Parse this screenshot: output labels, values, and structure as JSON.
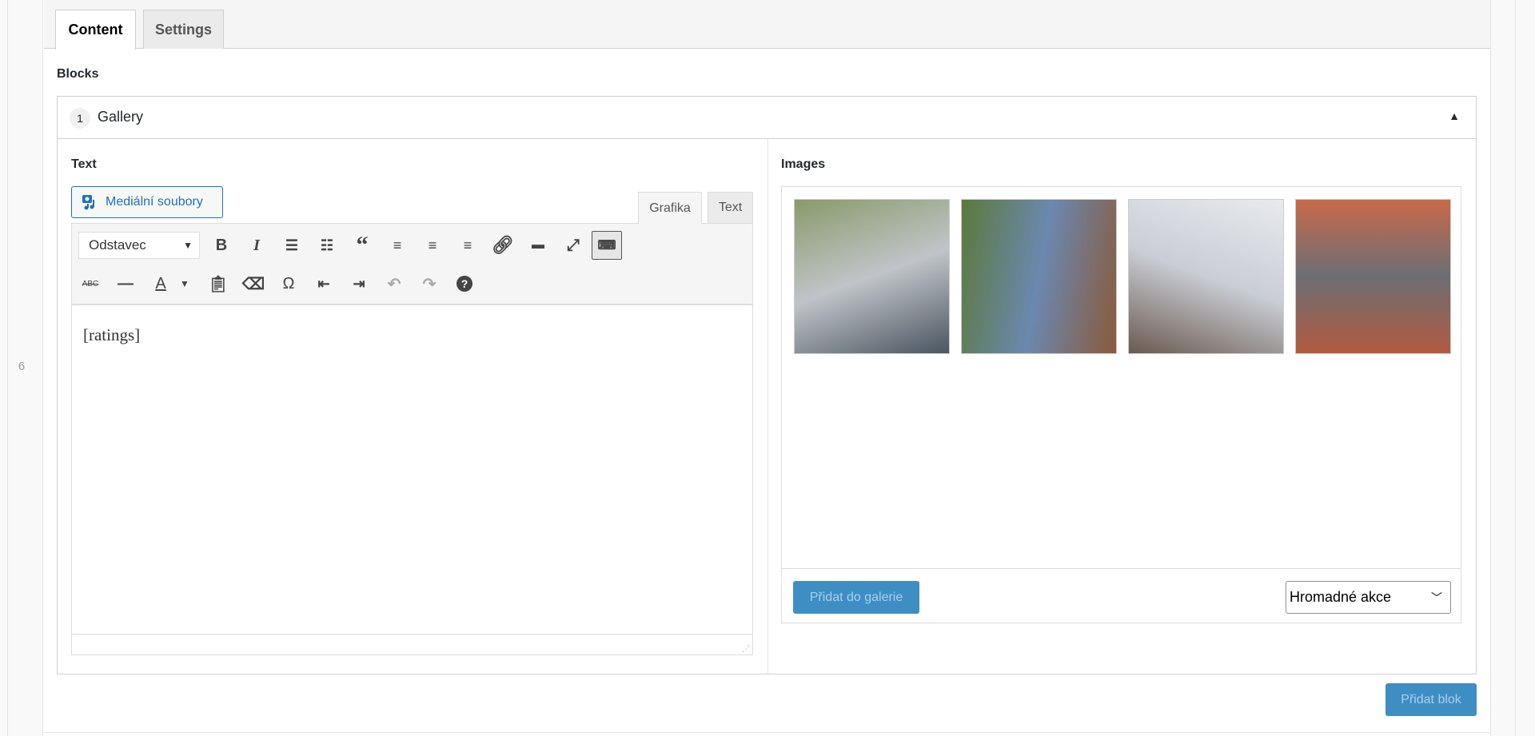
{
  "row_number": "6",
  "tabs": [
    {
      "label": "Content"
    },
    {
      "label": "Settings"
    }
  ],
  "blocks_label": "Blocks",
  "block": {
    "index": "1",
    "title": "Gallery",
    "collapse_icon": "▲"
  },
  "text_section": {
    "label": "Text",
    "media_button": "Mediální soubory",
    "editor_tabs": [
      "Grafika",
      "Text"
    ],
    "format_select": "Odstavec",
    "content": "[ratings]"
  },
  "images_section": {
    "label": "Images",
    "thumbnails": [
      {
        "name": "angle-grinder",
        "colors": [
          "#8a9a6a",
          "#c0c4c8",
          "#4a5560"
        ]
      },
      {
        "name": "man-with-birdhouse",
        "colors": [
          "#5b7a3a",
          "#6b88b0",
          "#8a5a3a"
        ]
      },
      {
        "name": "man-drilling-wall",
        "colors": [
          "#e8eaee",
          "#c9cdd4",
          "#6a5a50"
        ]
      },
      {
        "name": "house-facade",
        "colors": [
          "#c86a4a",
          "#6c6e74",
          "#b25a40"
        ]
      }
    ],
    "add_button": "Přidat do galerie",
    "bulk_select": "Hromadné akce"
  },
  "add_block_button": "Přidat blok",
  "colors": {
    "accent": "#2271b1",
    "button": "#3e8ec4"
  }
}
